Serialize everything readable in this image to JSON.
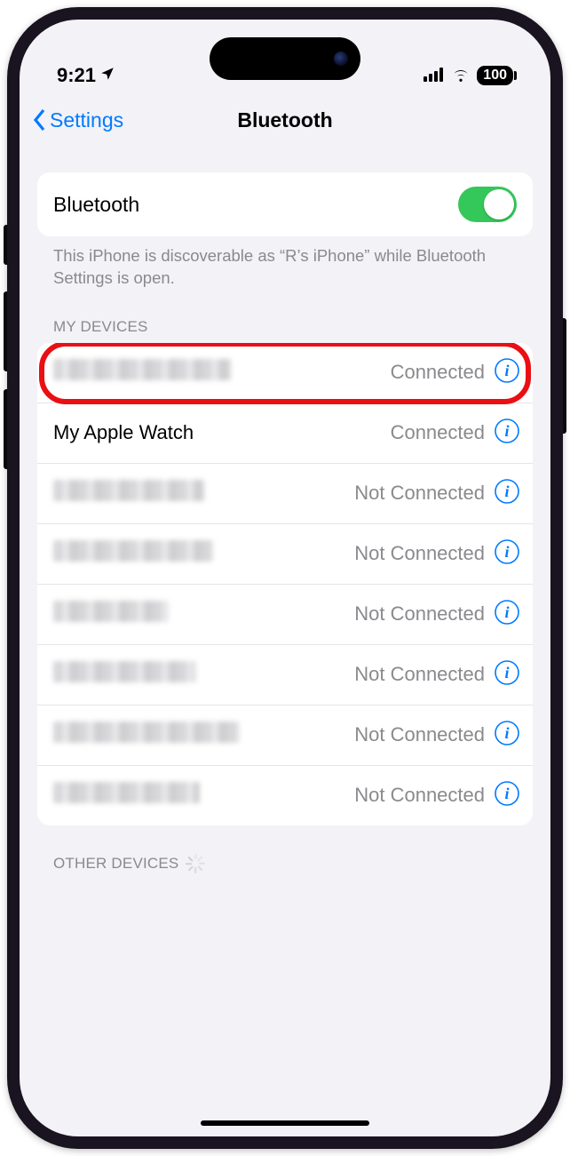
{
  "status_bar": {
    "time": "9:21",
    "battery": "100"
  },
  "nav": {
    "back_label": "Settings",
    "title": "Bluetooth"
  },
  "toggle": {
    "label": "Bluetooth",
    "on": true
  },
  "hint": "This iPhone is discoverable as “R’s iPhone” while Bluetooth Settings is open.",
  "sections": {
    "my_devices_header": "MY DEVICES",
    "other_devices_header": "OTHER DEVICES"
  },
  "devices": [
    {
      "name": "",
      "redacted": true,
      "status": "Connected",
      "highlighted": true,
      "blur_width": 200
    },
    {
      "name": "My Apple Watch",
      "redacted": false,
      "status": "Connected",
      "highlighted": false
    },
    {
      "name": "",
      "redacted": true,
      "status": "Not Connected",
      "highlighted": false,
      "blur_width": 170
    },
    {
      "name": "",
      "redacted": true,
      "status": "Not Connected",
      "highlighted": false,
      "blur_width": 180
    },
    {
      "name": "",
      "redacted": true,
      "status": "Not Connected",
      "highlighted": false,
      "blur_width": 130
    },
    {
      "name": "",
      "redacted": true,
      "status": "Not Connected",
      "highlighted": false,
      "blur_width": 160
    },
    {
      "name": "",
      "redacted": true,
      "status": "Not Connected",
      "highlighted": false,
      "blur_width": 210
    },
    {
      "name": "",
      "redacted": true,
      "status": "Not Connected",
      "highlighted": false,
      "blur_width": 165
    }
  ]
}
